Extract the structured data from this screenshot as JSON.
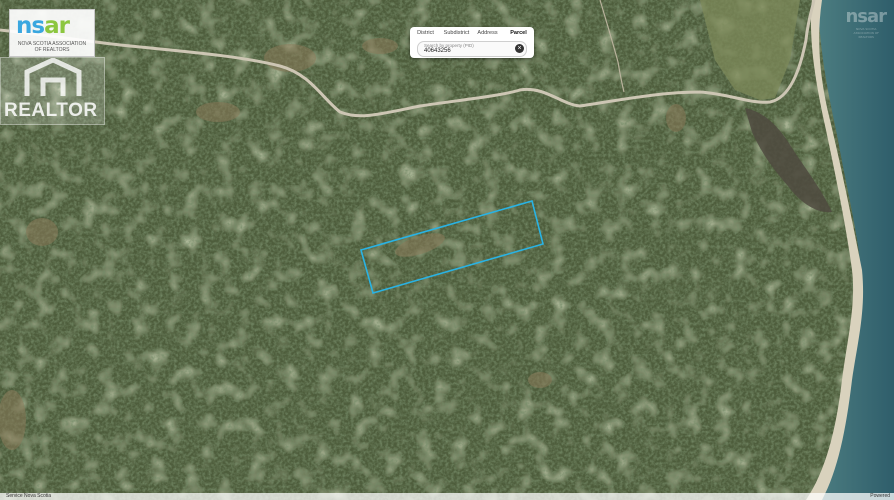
{
  "colors": {
    "parcel_outline": "#29b3e4",
    "land": "#4c5b3a",
    "water": "#3f6d73",
    "road": "#cfc8b8"
  },
  "logo": {
    "mark_ns": "ns",
    "mark_r": "ar",
    "subtitle": "NOVA SCOTIA ASSOCIATION OF REALTORS"
  },
  "realtor_watermark": {
    "text": "REALTOR"
  },
  "watermark_top": {
    "mark": "nsar",
    "subtitle": "NOVA SCOTIA ASSOCIATION OF REALTORS"
  },
  "search_panel": {
    "tabs": [
      {
        "label": "District",
        "active": false
      },
      {
        "label": "Subdistrict",
        "active": false
      },
      {
        "label": "Address",
        "active": false
      },
      {
        "label": "Parcel",
        "active": true
      }
    ],
    "placeholder": "Search by property (PID)",
    "value": "40643256",
    "clear_icon": "close-circle-icon"
  },
  "footer": {
    "left": "Service Nova Scotia",
    "right": "Powered"
  }
}
